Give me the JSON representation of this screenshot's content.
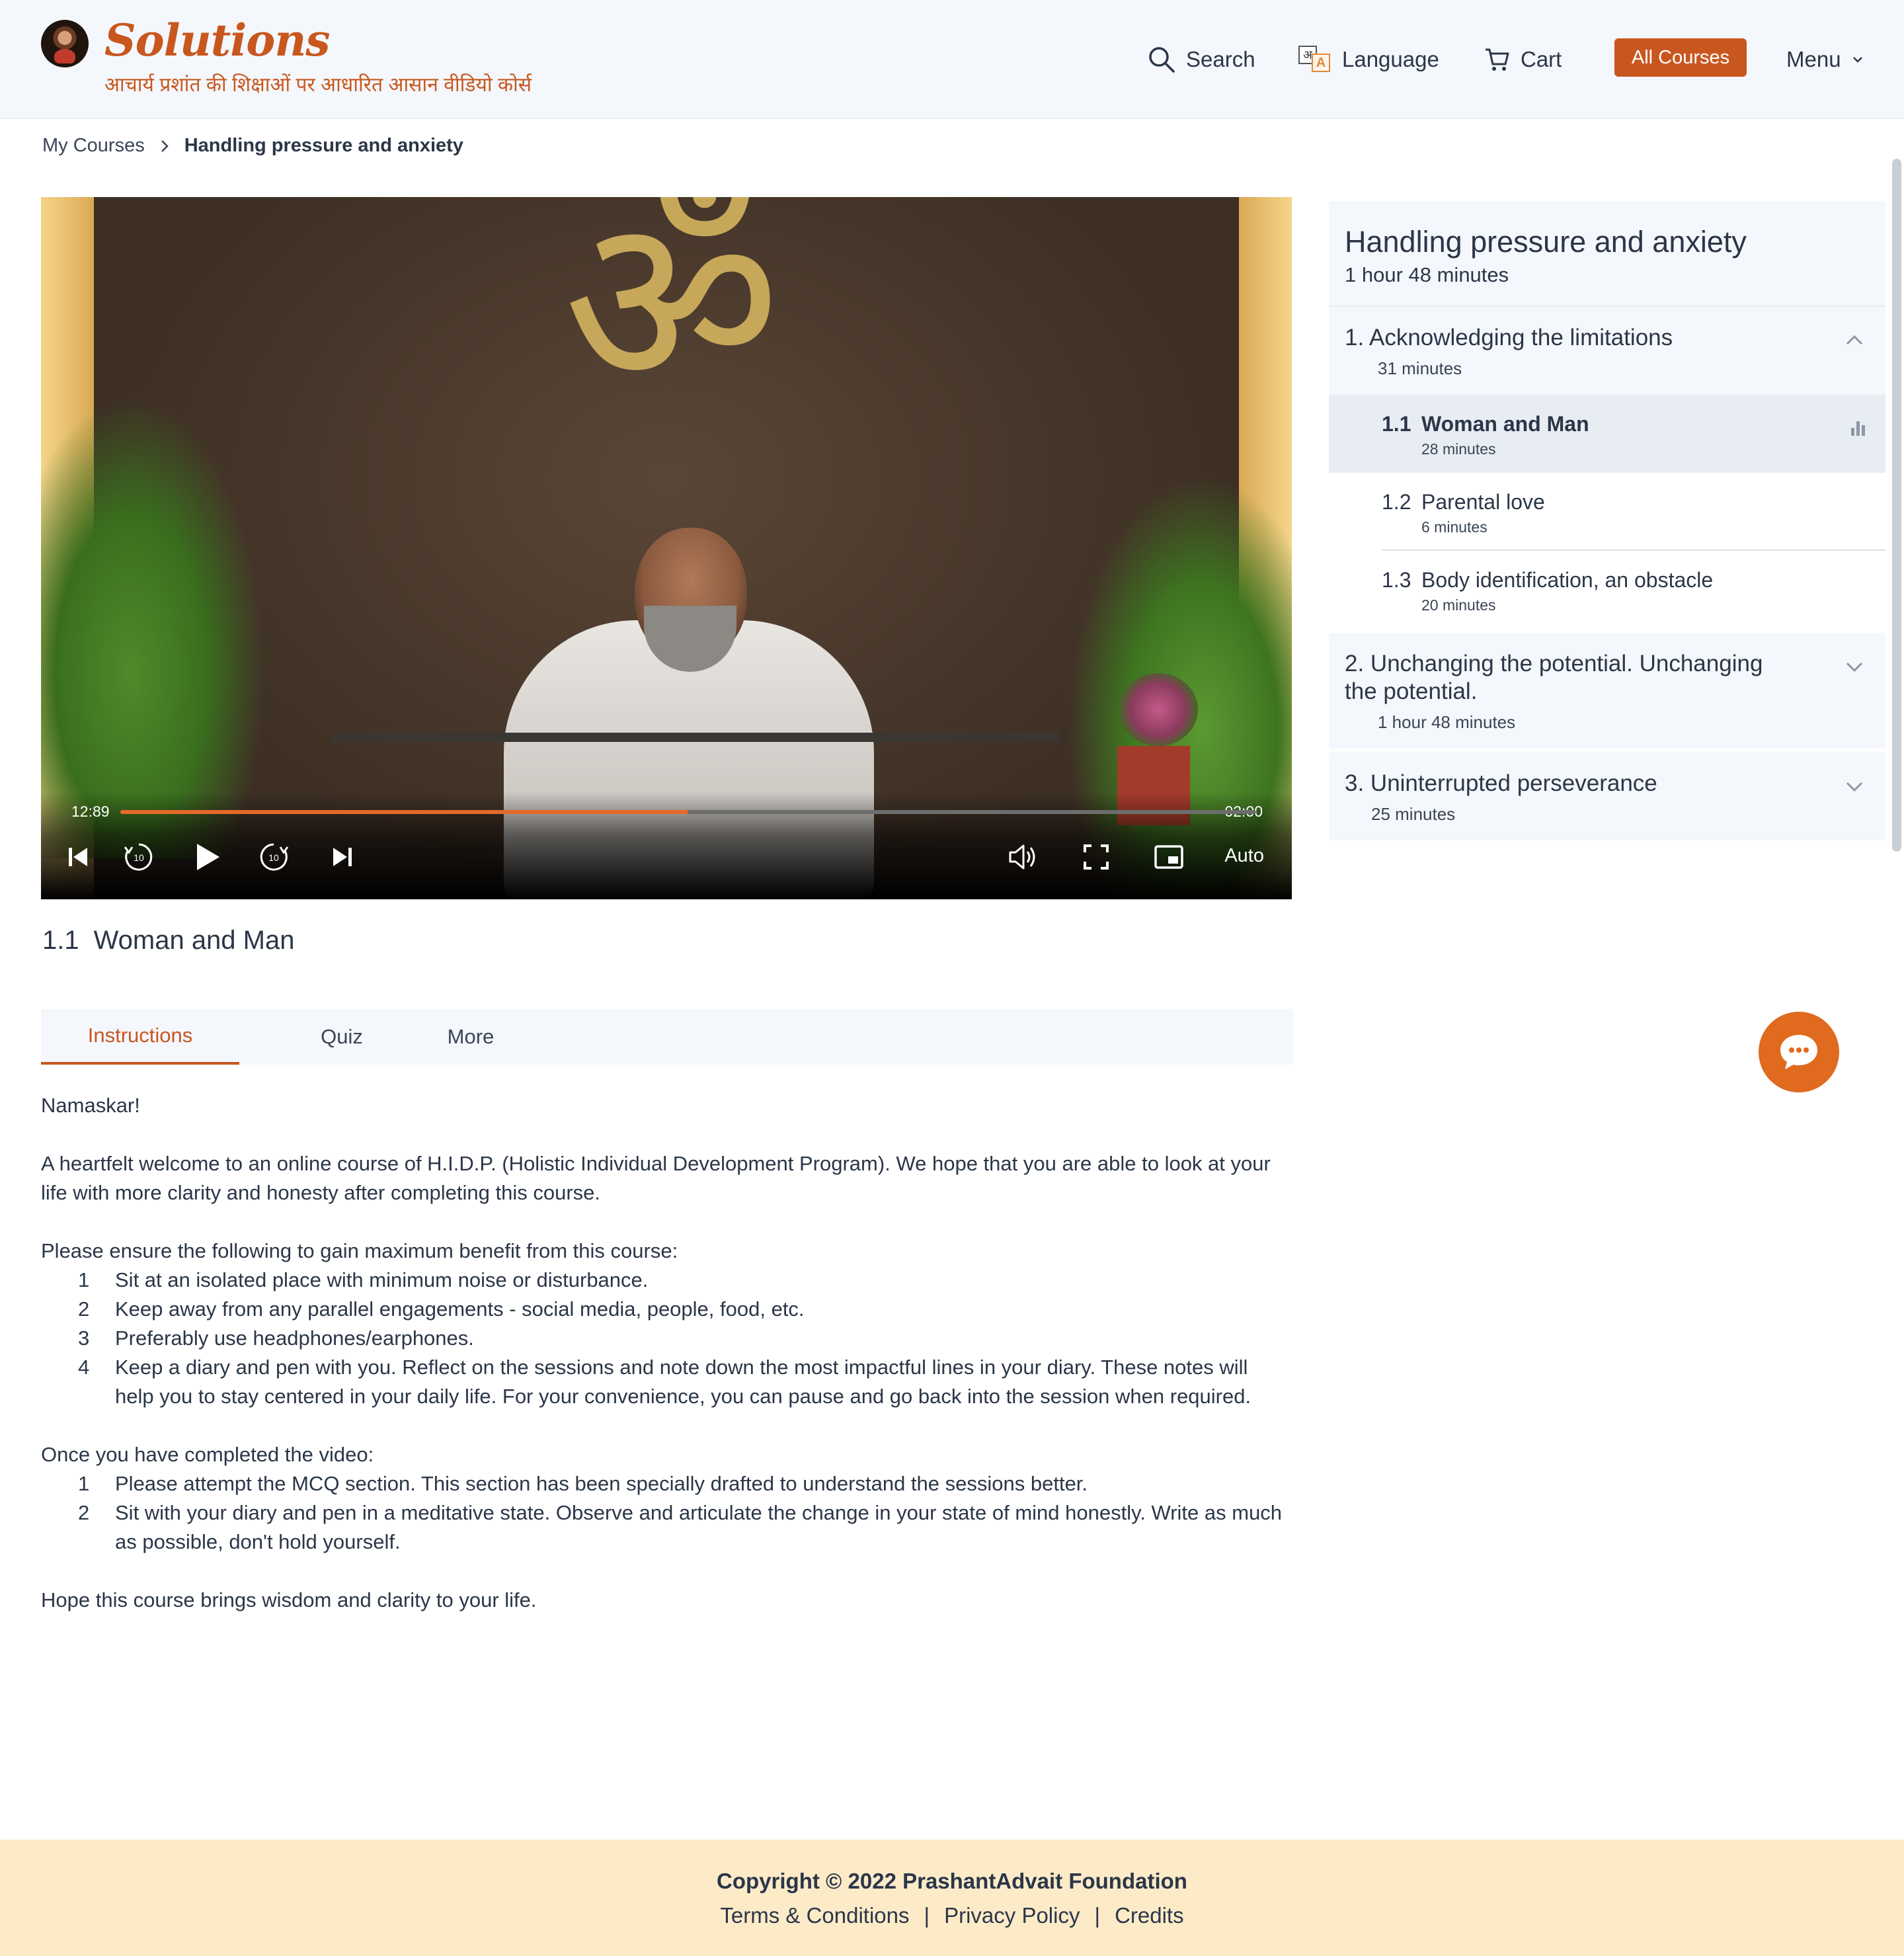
{
  "header": {
    "brand_title": "Solutions",
    "brand_subtitle": "आचार्य प्रशांत की शिक्षाओं पर आधारित आसान वीडियो कोर्स",
    "nav": {
      "search": "Search",
      "language": "Language",
      "cart": "Cart",
      "all_courses": "All Courses",
      "menu": "Menu"
    },
    "icons": [
      "avatar-logo",
      "search-icon",
      "language-icon",
      "cart-icon",
      "chevron-down-icon"
    ]
  },
  "breadcrumb": {
    "parent": "My Courses",
    "current": "Handling pressure and anxiety"
  },
  "player": {
    "time_elapsed": "12:89",
    "time_total": "02:00",
    "progress": 0.5,
    "quality": "Auto",
    "icons": [
      "skip-previous-icon",
      "rewind-10-icon",
      "play-icon",
      "forward-10-icon",
      "skip-next-icon",
      "volume-icon",
      "fullscreen-icon",
      "picture-in-picture-icon"
    ],
    "rewind_label": "10",
    "forward_label": "10",
    "accent_color": "#e46a2a"
  },
  "lesson": {
    "number": "1.1",
    "title": "Woman and Man"
  },
  "tabs": {
    "instructions": "Instructions",
    "quiz": "Quiz",
    "more": "More",
    "active": "Instructions"
  },
  "instructions": {
    "greeting": "Namaskar!",
    "welcome": "A heartfelt welcome to an online course of H.I.D.P. (Holistic Individual Development Program). We hope that you are able to look at your life with more clarity and honesty after completing this course.",
    "ensure_intro": "Please ensure the following to gain maximum benefit from this course:",
    "ensure_items": [
      {
        "n": "1",
        "text": "Sit at an isolated place with minimum noise or disturbance."
      },
      {
        "n": "2",
        "text": "Keep away from any parallel engagements - social media, people, food, etc."
      },
      {
        "n": "3",
        "text": "Preferably use headphones/earphones."
      },
      {
        "n": "4",
        "text": "Keep a diary and pen with you. Reflect on the sessions and note down the most impactful lines in your diary. These notes will help you to stay centered in your daily life. For your convenience, you can pause and go back into the session when required."
      }
    ],
    "after_intro": "Once you have completed the video:",
    "after_items": [
      {
        "n": "1",
        "text": "Please attempt the MCQ section. This section has been specially drafted to understand the sessions better."
      },
      {
        "n": "2",
        "text": "Sit with your diary and pen in a meditative state. Observe and articulate the change in your state of mind honestly. Write as much as possible, don't hold yourself."
      }
    ],
    "closing": "Hope this course brings wisdom and clarity to your life."
  },
  "sidebar": {
    "course_title": "Handling pressure and anxiety",
    "course_duration": "1 hour 48 minutes",
    "sections": [
      {
        "title": "1. Acknowledging the limitations",
        "duration": "31 minutes",
        "expanded": true,
        "lessons": [
          {
            "num": "1.1",
            "title": "Woman and Man",
            "duration": "28 minutes",
            "active": true
          },
          {
            "num": "1.2",
            "title": "Parental love",
            "duration": "6 minutes",
            "active": false
          },
          {
            "num": "1.3",
            "title": "Body identification, an obstacle",
            "duration": "20 minutes",
            "active": false
          }
        ]
      },
      {
        "title": "2. Unchanging the potential. Unchanging the potential.",
        "duration": "1 hour 48 minutes",
        "expanded": false
      },
      {
        "title": "3. Uninterrupted perseverance",
        "duration": "25 minutes",
        "expanded": false
      }
    ]
  },
  "chat": {
    "icon": "chat-bubble-icon"
  },
  "footer": {
    "copyright": "Copyright © 2022 PrashantAdvait Foundation",
    "links": {
      "terms": "Terms & Conditions",
      "privacy": "Privacy Policy",
      "credits": "Credits"
    },
    "separator": "|"
  },
  "colors": {
    "brand": "#c8571f",
    "header_bg": "#f4f7fb",
    "footer_bg": "#fdebc8",
    "text": "#2b3648"
  }
}
